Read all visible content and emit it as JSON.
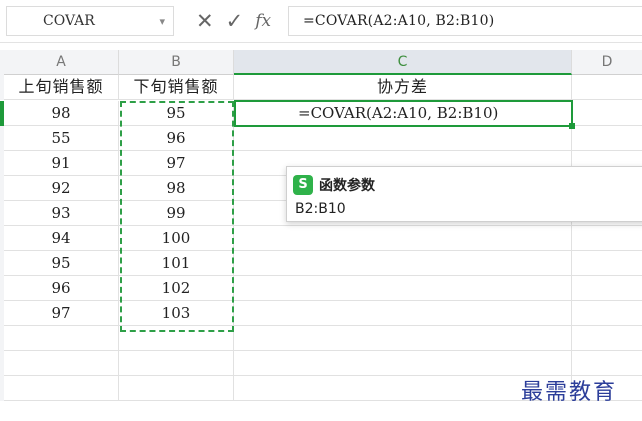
{
  "formula_bar": {
    "name_box": "COVAR",
    "dropdown_glyph": "▾",
    "cancel_glyph": "✕",
    "confirm_glyph": "✓",
    "fx_label": "fx",
    "formula": "=COVAR(A2:A10, B2:B10)"
  },
  "columns": [
    "A",
    "B",
    "C",
    "D"
  ],
  "active_column": "C",
  "table": {
    "headers": {
      "A": "上旬销售额",
      "B": "下旬销售额",
      "C": "协方差",
      "D": ""
    },
    "rows": [
      {
        "A": "98",
        "B": "95",
        "C": "=COVAR(A2:A10, B2:B10)"
      },
      {
        "A": "55",
        "B": "96",
        "C": ""
      },
      {
        "A": "91",
        "B": "97",
        "C": ""
      },
      {
        "A": "92",
        "B": "98",
        "C": ""
      },
      {
        "A": "93",
        "B": "99",
        "C": ""
      },
      {
        "A": "94",
        "B": "100",
        "C": ""
      },
      {
        "A": "95",
        "B": "101",
        "C": ""
      },
      {
        "A": "96",
        "B": "102",
        "C": ""
      },
      {
        "A": "97",
        "B": "103",
        "C": ""
      },
      {
        "A": "",
        "B": "",
        "C": ""
      },
      {
        "A": "",
        "B": "",
        "C": ""
      },
      {
        "A": "",
        "B": "",
        "C": ""
      }
    ]
  },
  "tooltip": {
    "icon_letter": "S",
    "title": "函数参数",
    "argument": "B2:B10"
  },
  "watermark": "最需教育",
  "colors": {
    "accent_green": "#1e9a3a",
    "header_bg": "#f3f4f6",
    "watermark_blue": "#2c3e9a"
  }
}
